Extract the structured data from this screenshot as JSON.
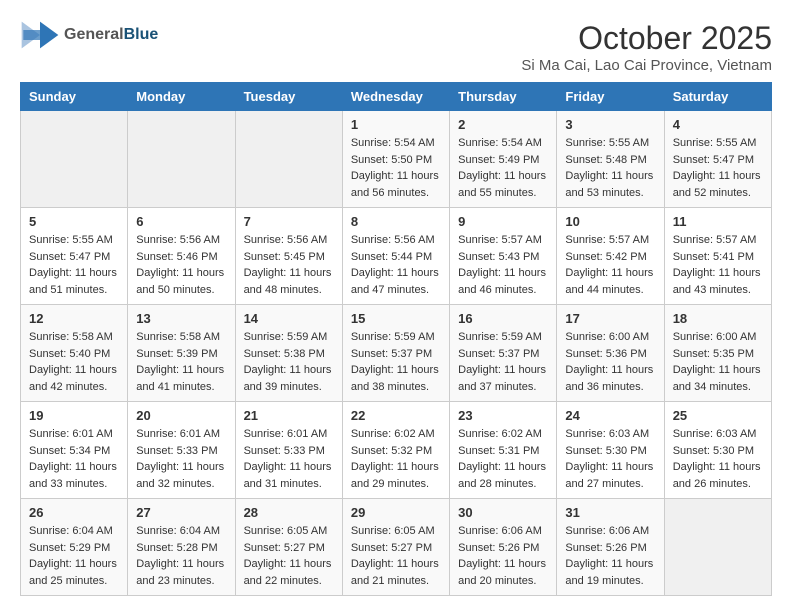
{
  "logo": {
    "text_general": "General",
    "text_blue": "Blue"
  },
  "title": "October 2025",
  "subtitle": "Si Ma Cai, Lao Cai Province, Vietnam",
  "headers": [
    "Sunday",
    "Monday",
    "Tuesday",
    "Wednesday",
    "Thursday",
    "Friday",
    "Saturday"
  ],
  "weeks": [
    [
      {
        "day": "",
        "info": ""
      },
      {
        "day": "",
        "info": ""
      },
      {
        "day": "",
        "info": ""
      },
      {
        "day": "1",
        "info": "Sunrise: 5:54 AM\nSunset: 5:50 PM\nDaylight: 11 hours\nand 56 minutes."
      },
      {
        "day": "2",
        "info": "Sunrise: 5:54 AM\nSunset: 5:49 PM\nDaylight: 11 hours\nand 55 minutes."
      },
      {
        "day": "3",
        "info": "Sunrise: 5:55 AM\nSunset: 5:48 PM\nDaylight: 11 hours\nand 53 minutes."
      },
      {
        "day": "4",
        "info": "Sunrise: 5:55 AM\nSunset: 5:47 PM\nDaylight: 11 hours\nand 52 minutes."
      }
    ],
    [
      {
        "day": "5",
        "info": "Sunrise: 5:55 AM\nSunset: 5:47 PM\nDaylight: 11 hours\nand 51 minutes."
      },
      {
        "day": "6",
        "info": "Sunrise: 5:56 AM\nSunset: 5:46 PM\nDaylight: 11 hours\nand 50 minutes."
      },
      {
        "day": "7",
        "info": "Sunrise: 5:56 AM\nSunset: 5:45 PM\nDaylight: 11 hours\nand 48 minutes."
      },
      {
        "day": "8",
        "info": "Sunrise: 5:56 AM\nSunset: 5:44 PM\nDaylight: 11 hours\nand 47 minutes."
      },
      {
        "day": "9",
        "info": "Sunrise: 5:57 AM\nSunset: 5:43 PM\nDaylight: 11 hours\nand 46 minutes."
      },
      {
        "day": "10",
        "info": "Sunrise: 5:57 AM\nSunset: 5:42 PM\nDaylight: 11 hours\nand 44 minutes."
      },
      {
        "day": "11",
        "info": "Sunrise: 5:57 AM\nSunset: 5:41 PM\nDaylight: 11 hours\nand 43 minutes."
      }
    ],
    [
      {
        "day": "12",
        "info": "Sunrise: 5:58 AM\nSunset: 5:40 PM\nDaylight: 11 hours\nand 42 minutes."
      },
      {
        "day": "13",
        "info": "Sunrise: 5:58 AM\nSunset: 5:39 PM\nDaylight: 11 hours\nand 41 minutes."
      },
      {
        "day": "14",
        "info": "Sunrise: 5:59 AM\nSunset: 5:38 PM\nDaylight: 11 hours\nand 39 minutes."
      },
      {
        "day": "15",
        "info": "Sunrise: 5:59 AM\nSunset: 5:37 PM\nDaylight: 11 hours\nand 38 minutes."
      },
      {
        "day": "16",
        "info": "Sunrise: 5:59 AM\nSunset: 5:37 PM\nDaylight: 11 hours\nand 37 minutes."
      },
      {
        "day": "17",
        "info": "Sunrise: 6:00 AM\nSunset: 5:36 PM\nDaylight: 11 hours\nand 36 minutes."
      },
      {
        "day": "18",
        "info": "Sunrise: 6:00 AM\nSunset: 5:35 PM\nDaylight: 11 hours\nand 34 minutes."
      }
    ],
    [
      {
        "day": "19",
        "info": "Sunrise: 6:01 AM\nSunset: 5:34 PM\nDaylight: 11 hours\nand 33 minutes."
      },
      {
        "day": "20",
        "info": "Sunrise: 6:01 AM\nSunset: 5:33 PM\nDaylight: 11 hours\nand 32 minutes."
      },
      {
        "day": "21",
        "info": "Sunrise: 6:01 AM\nSunset: 5:33 PM\nDaylight: 11 hours\nand 31 minutes."
      },
      {
        "day": "22",
        "info": "Sunrise: 6:02 AM\nSunset: 5:32 PM\nDaylight: 11 hours\nand 29 minutes."
      },
      {
        "day": "23",
        "info": "Sunrise: 6:02 AM\nSunset: 5:31 PM\nDaylight: 11 hours\nand 28 minutes."
      },
      {
        "day": "24",
        "info": "Sunrise: 6:03 AM\nSunset: 5:30 PM\nDaylight: 11 hours\nand 27 minutes."
      },
      {
        "day": "25",
        "info": "Sunrise: 6:03 AM\nSunset: 5:30 PM\nDaylight: 11 hours\nand 26 minutes."
      }
    ],
    [
      {
        "day": "26",
        "info": "Sunrise: 6:04 AM\nSunset: 5:29 PM\nDaylight: 11 hours\nand 25 minutes."
      },
      {
        "day": "27",
        "info": "Sunrise: 6:04 AM\nSunset: 5:28 PM\nDaylight: 11 hours\nand 23 minutes."
      },
      {
        "day": "28",
        "info": "Sunrise: 6:05 AM\nSunset: 5:27 PM\nDaylight: 11 hours\nand 22 minutes."
      },
      {
        "day": "29",
        "info": "Sunrise: 6:05 AM\nSunset: 5:27 PM\nDaylight: 11 hours\nand 21 minutes."
      },
      {
        "day": "30",
        "info": "Sunrise: 6:06 AM\nSunset: 5:26 PM\nDaylight: 11 hours\nand 20 minutes."
      },
      {
        "day": "31",
        "info": "Sunrise: 6:06 AM\nSunset: 5:26 PM\nDaylight: 11 hours\nand 19 minutes."
      },
      {
        "day": "",
        "info": ""
      }
    ]
  ]
}
